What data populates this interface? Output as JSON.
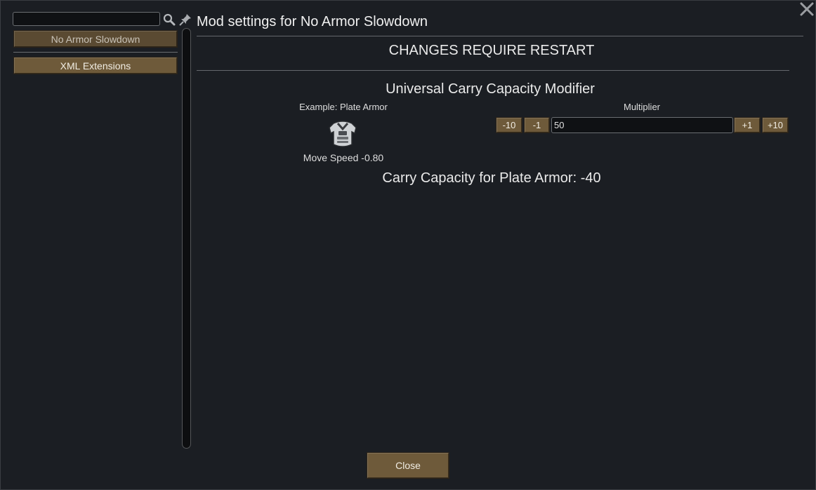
{
  "header": {
    "title": "Mod settings for No Armor Slowdown"
  },
  "sidebar": {
    "search": {
      "value": "",
      "placeholder": ""
    },
    "items": [
      {
        "label": "No Armor Slowdown",
        "selected": true
      },
      {
        "label": "XML Extensions",
        "selected": false
      }
    ]
  },
  "main": {
    "restart_notice": "CHANGES REQUIRE RESTART",
    "section_title": "Universal Carry Capacity Modifier",
    "example": {
      "label": "Example: Plate Armor",
      "icon": "plate-armor-icon",
      "move_speed": "Move Speed -0.80"
    },
    "multiplier": {
      "label": "Multiplier",
      "value": "50",
      "buttons": [
        "-10",
        "-1",
        "+1",
        "+10"
      ]
    },
    "result": "Carry Capacity for Plate Armor: -40"
  },
  "footer": {
    "close_label": "Close"
  },
  "colors": {
    "background": "#1b1e22",
    "button": "#6e5a3a",
    "button_selected": "#5a4a32",
    "text": "#e8e8e8"
  }
}
